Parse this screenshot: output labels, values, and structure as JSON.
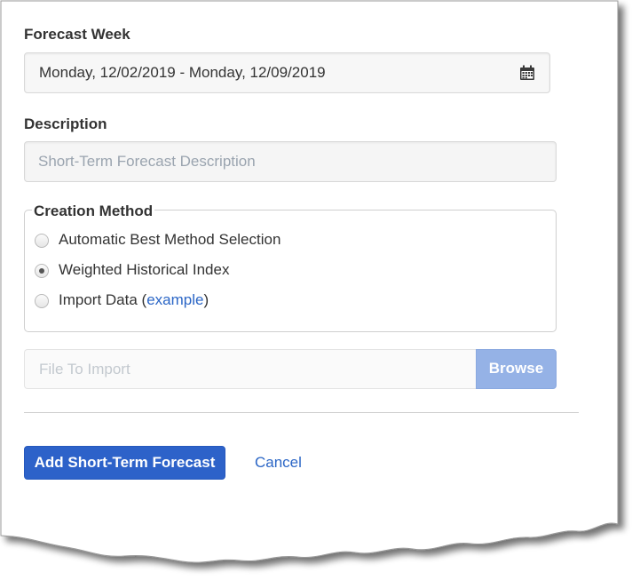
{
  "form": {
    "forecast_week": {
      "label": "Forecast Week",
      "value": "Monday, 12/02/2019 - Monday, 12/09/2019",
      "icon": "calendar-icon"
    },
    "description": {
      "label": "Description",
      "placeholder": "Short-Term Forecast Description",
      "value": ""
    },
    "creation_method": {
      "legend": "Creation Method",
      "options": [
        {
          "label": "Automatic Best Method Selection",
          "selected": false
        },
        {
          "label": "Weighted Historical Index",
          "selected": true
        },
        {
          "label": "Import Data (",
          "link": "example",
          "suffix": ")",
          "selected": false
        }
      ]
    },
    "file_import": {
      "placeholder": "File To Import",
      "browse_label": "Browse"
    }
  },
  "actions": {
    "submit_label": "Add Short-Term Forecast",
    "cancel_label": "Cancel"
  },
  "colors": {
    "primary": "#2d62c9",
    "browse_disabled": "#95b2e6",
    "link": "#2b66c6"
  }
}
